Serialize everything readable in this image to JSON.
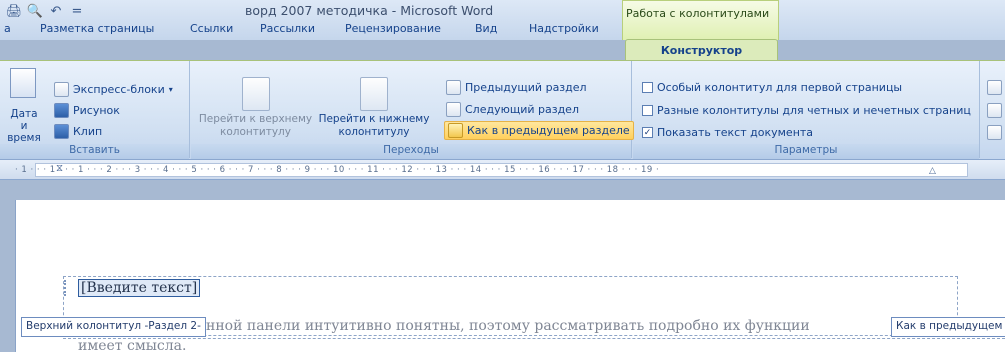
{
  "window": {
    "title": "ворд 2007 методичка - Microsoft Word"
  },
  "qat": {
    "icons": [
      "print-preview-icon",
      "undo-icon",
      "customize-icon"
    ],
    "separator": "="
  },
  "context_header": "Работа с колонтитулами",
  "tabs": [
    "а",
    "Разметка страницы",
    "Ссылки",
    "Рассылки",
    "Рецензирование",
    "Вид",
    "Надстройки"
  ],
  "active_tab": "Конструктор",
  "groups": {
    "insert": {
      "label": "Вставить",
      "date_time": "Дата и время",
      "quick_parts": "Экспресс-блоки",
      "picture": "Рисунок",
      "clip": "Клип"
    },
    "navigation": {
      "label": "Переходы",
      "go_header": "Перейти к верхнему колонтитулу",
      "go_footer": "Перейти к нижнему колонтитулу",
      "prev_section": "Предыдущий раздел",
      "next_section": "Следующий раздел",
      "link_prev": "Как в предыдущем разделе"
    },
    "options": {
      "label": "Параметры",
      "different_first": {
        "label": "Особый колонтитул для первой страницы",
        "checked": false
      },
      "different_odd_even": {
        "label": "Разные колонтитулы для четных и нечетных страниц",
        "checked": false
      },
      "show_doc_text": {
        "label": "Показать текст документа",
        "checked": true
      }
    }
  },
  "ruler": {
    "text": "· 1 · ·  · 1 · · · 1 · · · 2 · · · 3 · · · 4 · · · 5 · · · 6 · · · 7 · · · 8 · · · 9 · · · 10 · · · 11 · · · 12 · · · 13 · · · 14 · · · 15 · · · 16 · · · 17 · · · 18 · · · 19 ·"
  },
  "document": {
    "placeholder": "[Введите текст]",
    "header_tag": "Верхний колонтитул -Раздел 2-",
    "same_as_prev_tag": "Как в предыдущем",
    "body_line1": "нной панели интуитивно понятны, поэтому рассматривать подробно их функции",
    "body_line2": "имеет смысла."
  },
  "colors": {
    "ribbon": "#dbe7f6",
    "context_green": "#dcebbb",
    "highlight": "#ffd05d"
  }
}
